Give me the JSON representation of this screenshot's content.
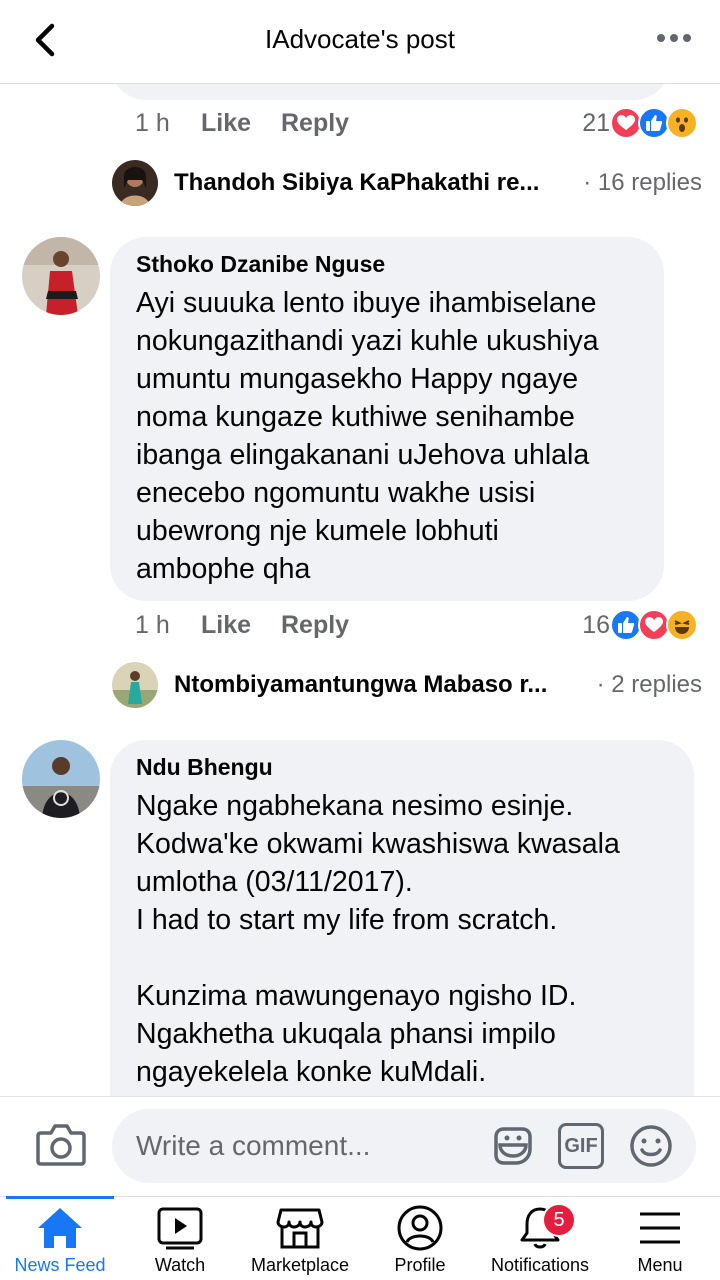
{
  "header": {
    "title": "IAdvocate's post",
    "back_icon": "chevron-left-icon",
    "more_icon": "ellipsis-icon"
  },
  "comments": [
    {
      "time": "1 h",
      "like_label": "Like",
      "reply_label": "Reply",
      "reaction_count": "21",
      "reactions": [
        "love",
        "like",
        "wow"
      ],
      "reply_preview": {
        "name": "Thandoh Sibiya KaPhakathi re...",
        "count": "· 16 replies"
      }
    },
    {
      "author": "Sthoko Dzanibe Nguse",
      "text": "Ayi suuuka lento ibuye ihambiselane\nnokungazithandi yazi kuhle ukushiya\numuntu mungasekho Happy ngaye\nnoma kungaze kuthiwe senihambe\nibanga elingakanani uJehova uhlala\nenecebo ngomuntu wakhe usisi\nubewrong nje kumele lobhuti\nambophe qha",
      "time": "1 h",
      "like_label": "Like",
      "reply_label": "Reply",
      "reaction_count": "16",
      "reactions": [
        "like",
        "love",
        "haha"
      ],
      "reply_preview": {
        "name": "Ntombiyamantungwa Mabaso r...",
        "count": "· 2 replies"
      }
    },
    {
      "author": "Ndu Bhengu",
      "text": "Ngake ngabhekana nesimo esinje.\nKodwa'ke okwami kwashiswa kwasala\numlotha (03/11/2017).\nI had to start my life from scratch.\n\nKunzima mawungenayo ngisho ID.\nNgakhetha ukuqala phansi impilo\nngayekelela konke kuMdali."
    }
  ],
  "composer": {
    "placeholder": "Write a comment...",
    "gif_label": "GIF"
  },
  "tabs": [
    {
      "label": "News Feed",
      "icon": "home-icon",
      "active": true
    },
    {
      "label": "Watch",
      "icon": "watch-icon"
    },
    {
      "label": "Marketplace",
      "icon": "marketplace-icon"
    },
    {
      "label": "Profile",
      "icon": "profile-icon"
    },
    {
      "label": "Notifications",
      "icon": "bell-icon",
      "badge": "5"
    },
    {
      "label": "Menu",
      "icon": "menu-icon"
    }
  ],
  "colors": {
    "accent": "#1877f2",
    "bubble": "#f0f2f5",
    "badge": "#e41e3f",
    "love": "#f33e58",
    "wow": "#f7b125"
  }
}
